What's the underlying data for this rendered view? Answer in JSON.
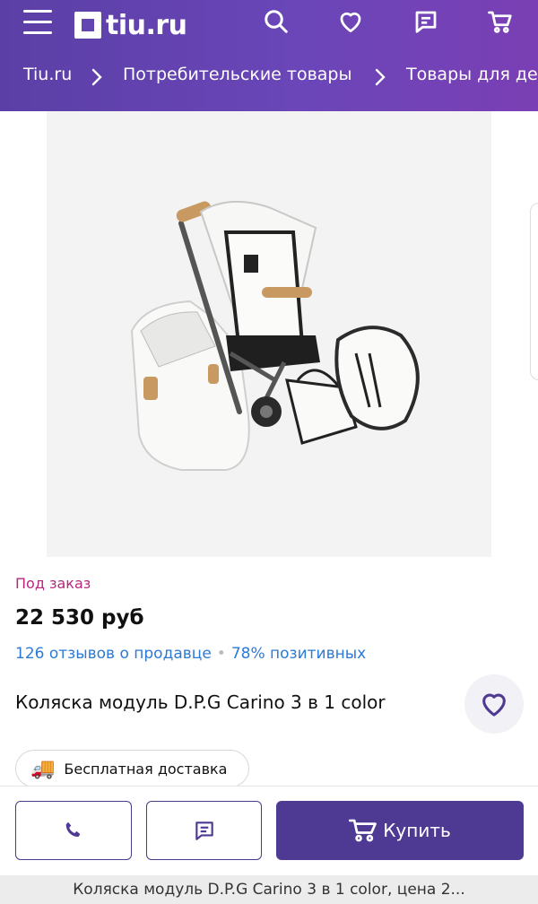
{
  "header": {
    "logo_text": "tiu.ru",
    "icons": [
      "menu-icon",
      "search-icon",
      "heart-icon",
      "message-icon",
      "cart-icon"
    ]
  },
  "breadcrumb": [
    {
      "label": "Tiu.ru"
    },
    {
      "label": "Потребительские товары"
    },
    {
      "label": "Товары для де"
    }
  ],
  "product": {
    "availability": "Под заказ",
    "price": "22 530 руб",
    "reviews": "126 отзывов о продавце",
    "positive": "78% позитивных",
    "title": "Коляска модуль D.P.G Carino 3 в 1 color",
    "delivery": "Бесплатная доставка"
  },
  "actions": {
    "buy_label": "Купить"
  },
  "footer": {
    "page_title": "Коляска модуль D.P.G Carino 3 в 1 color, цена 2..."
  },
  "colors": {
    "header": "#6245b0",
    "accent": "#4f3a93",
    "availability": "#b5287b",
    "link": "#2c7ad6"
  }
}
